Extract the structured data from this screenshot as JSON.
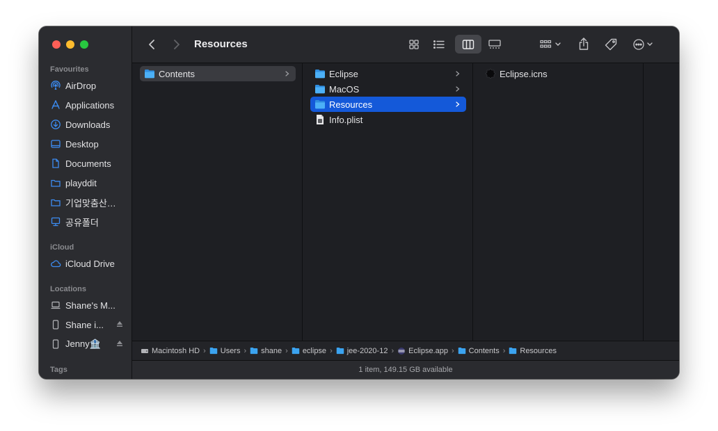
{
  "window": {
    "title": "Resources"
  },
  "colors": {
    "accent": "#1459d9",
    "folder": "#3ba3f0",
    "sidebar_icon": "#3c8cf2"
  },
  "sidebar": {
    "favourites_title": "Favourites",
    "favourites": [
      {
        "label": "AirDrop",
        "icon": "airdrop-icon"
      },
      {
        "label": "Applications",
        "icon": "applications-icon"
      },
      {
        "label": "Downloads",
        "icon": "downloads-icon"
      },
      {
        "label": "Desktop",
        "icon": "desktop-icon"
      },
      {
        "label": "Documents",
        "icon": "documents-icon"
      },
      {
        "label": "playddit",
        "icon": "folder-icon"
      },
      {
        "label": "기업맞춤산…",
        "icon": "folder-icon"
      },
      {
        "label": "공유폴더",
        "icon": "shared-folder-icon"
      }
    ],
    "icloud_title": "iCloud",
    "icloud": [
      {
        "label": "iCloud Drive",
        "icon": "cloud-icon"
      }
    ],
    "locations_title": "Locations",
    "locations": [
      {
        "label": "Shane's M...",
        "icon": "laptop-icon"
      },
      {
        "label": "Shane i...",
        "icon": "disk-icon"
      },
      {
        "label": "Jenny🏦",
        "icon": "disk-icon"
      }
    ],
    "tags_title": "Tags"
  },
  "columns": [
    {
      "items": [
        {
          "label": "Contents",
          "icon": "folder-icon",
          "has_children": true,
          "selected": "inactive"
        }
      ]
    },
    {
      "items": [
        {
          "label": "Eclipse",
          "icon": "folder-icon",
          "has_children": true
        },
        {
          "label": "MacOS",
          "icon": "folder-icon",
          "has_children": true
        },
        {
          "label": "Resources",
          "icon": "folder-icon",
          "has_children": true,
          "selected": "active"
        },
        {
          "label": "Info.plist",
          "icon": "plist-file-icon",
          "has_children": false
        }
      ]
    },
    {
      "items": [
        {
          "label": "Eclipse.icns",
          "icon": "eclipse-icns-icon",
          "has_children": false
        }
      ]
    }
  ],
  "pathbar": [
    {
      "label": "Macintosh HD",
      "icon": "hard-drive-icon"
    },
    {
      "label": "Users",
      "icon": "folder-icon"
    },
    {
      "label": "shane",
      "icon": "folder-icon"
    },
    {
      "label": "eclipse",
      "icon": "folder-icon"
    },
    {
      "label": "jee-2020-12",
      "icon": "folder-icon"
    },
    {
      "label": "Eclipse.app",
      "icon": "app-icon"
    },
    {
      "label": "Contents",
      "icon": "folder-icon"
    },
    {
      "label": "Resources",
      "icon": "folder-icon"
    }
  ],
  "status": {
    "text": "1 item, 149.15 GB available"
  }
}
